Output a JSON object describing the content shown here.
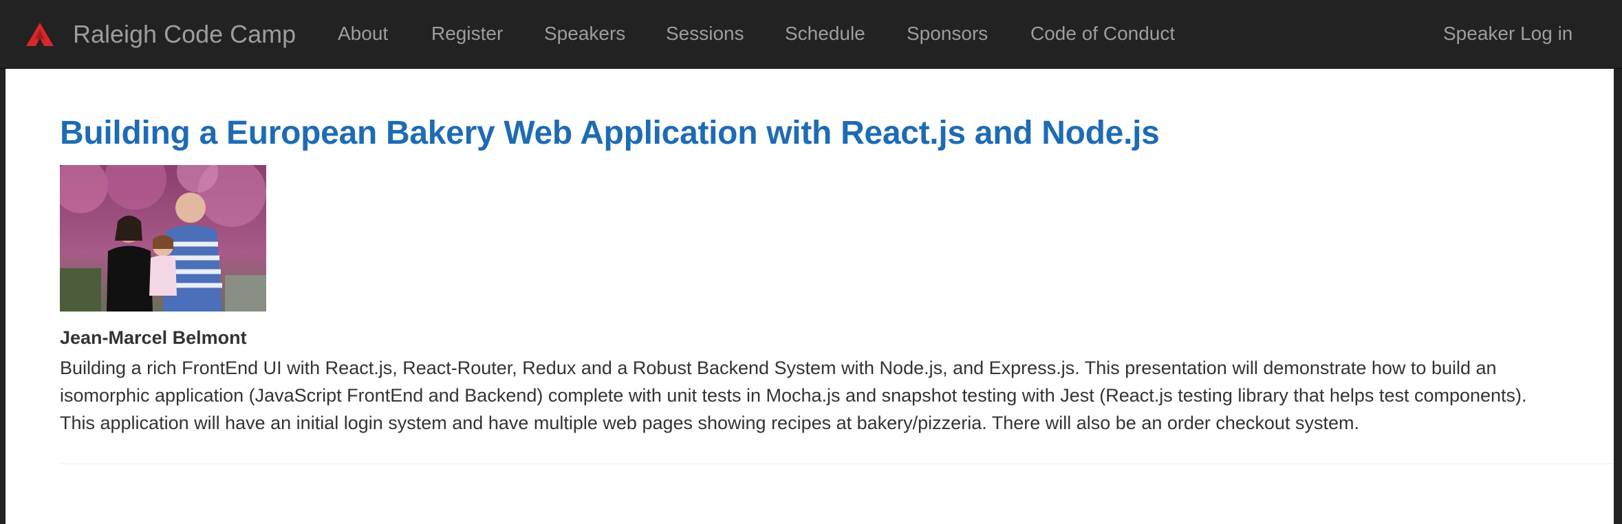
{
  "navbar": {
    "brand_text": "Raleigh Code Camp",
    "logo_icon": "red-triangle-logo-icon",
    "links": [
      "About",
      "Register",
      "Speakers",
      "Sessions",
      "Schedule",
      "Sponsors",
      "Code of Conduct"
    ],
    "login_label": "Speaker Log in"
  },
  "session": {
    "title": "Building a European Bakery Web Application with React.js and Node.js",
    "speaker_name": "Jean-Marcel Belmont",
    "description_lines": [
      "Building a rich FrontEnd UI with React.js, React-Router, Redux and a Robust Backend System with Node.js, and Express.js. This presentation will demonstrate how to build an",
      "isomorphic application (JavaScript FrontEnd and Backend) complete with unit tests in Mocha.js and snapshot testing with Jest (React.js testing library that helps test components).",
      "This application will have an initial login system and have multiple web pages showing recipes at bakery/pizzeria. There will also be an order checkout system."
    ]
  },
  "colors": {
    "navbar_bg": "#222222",
    "nav_text": "#9d9d9d",
    "title_blue": "#1e6bb5",
    "logo_red": "#d9262b",
    "body_text": "#333333"
  }
}
